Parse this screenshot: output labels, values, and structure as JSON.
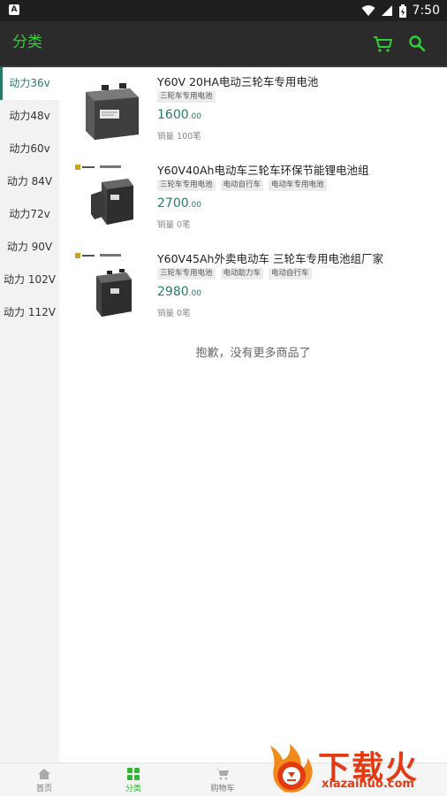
{
  "status_bar": {
    "left_badge": "A",
    "time": "7:50",
    "icons": [
      "wifi-icon",
      "signal-icon",
      "battery-icon"
    ]
  },
  "app_bar": {
    "title": "分类",
    "icons": [
      "cart-icon",
      "search-icon"
    ],
    "accent_color": "#2fcf38"
  },
  "sidebar": {
    "items": [
      {
        "label": "动力36v",
        "active": true
      },
      {
        "label": "动力48v",
        "active": false
      },
      {
        "label": "动力60v",
        "active": false
      },
      {
        "label": "动力 84V",
        "active": false
      },
      {
        "label": "动力72v",
        "active": false
      },
      {
        "label": "动力 90V",
        "active": false
      },
      {
        "label": "动力 102V",
        "active": false
      },
      {
        "label": "动力 112V",
        "active": false
      }
    ],
    "active_color": "#2a7a6a"
  },
  "products": [
    {
      "title": "Y60V 20HA电动三轮车专用电池",
      "tags": [
        "三轮车专用电池"
      ],
      "price_int": "1600",
      "price_dec": ".00",
      "sales": "销量 100笔"
    },
    {
      "title": "Y60V40Ah电动车三轮车环保节能锂电池组",
      "tags": [
        "三轮车专用电池",
        "电动自行车",
        "电动车专用电池"
      ],
      "price_int": "2700",
      "price_dec": ".00",
      "sales": "销量 0笔"
    },
    {
      "title": "Y60V45Ah外卖电动车 三轮车专用电池组厂家",
      "tags": [
        "三轮车专用电池",
        "电动助力车",
        "电动自行车"
      ],
      "price_int": "2980",
      "price_dec": ".00",
      "sales": "销量 0笔"
    }
  ],
  "list_footer": "抱歉，没有更多商品了",
  "bottom_nav": {
    "items": [
      {
        "label": "首页",
        "icon": "home-icon",
        "active": false
      },
      {
        "label": "分类",
        "icon": "category-icon",
        "active": true
      },
      {
        "label": "购物车",
        "icon": "cart-icon",
        "active": false
      }
    ],
    "active_color": "#2fb82f"
  },
  "watermark": {
    "text_cn": "下载火",
    "text_en": "xiazaihuo.com",
    "color": "#e23a12"
  }
}
